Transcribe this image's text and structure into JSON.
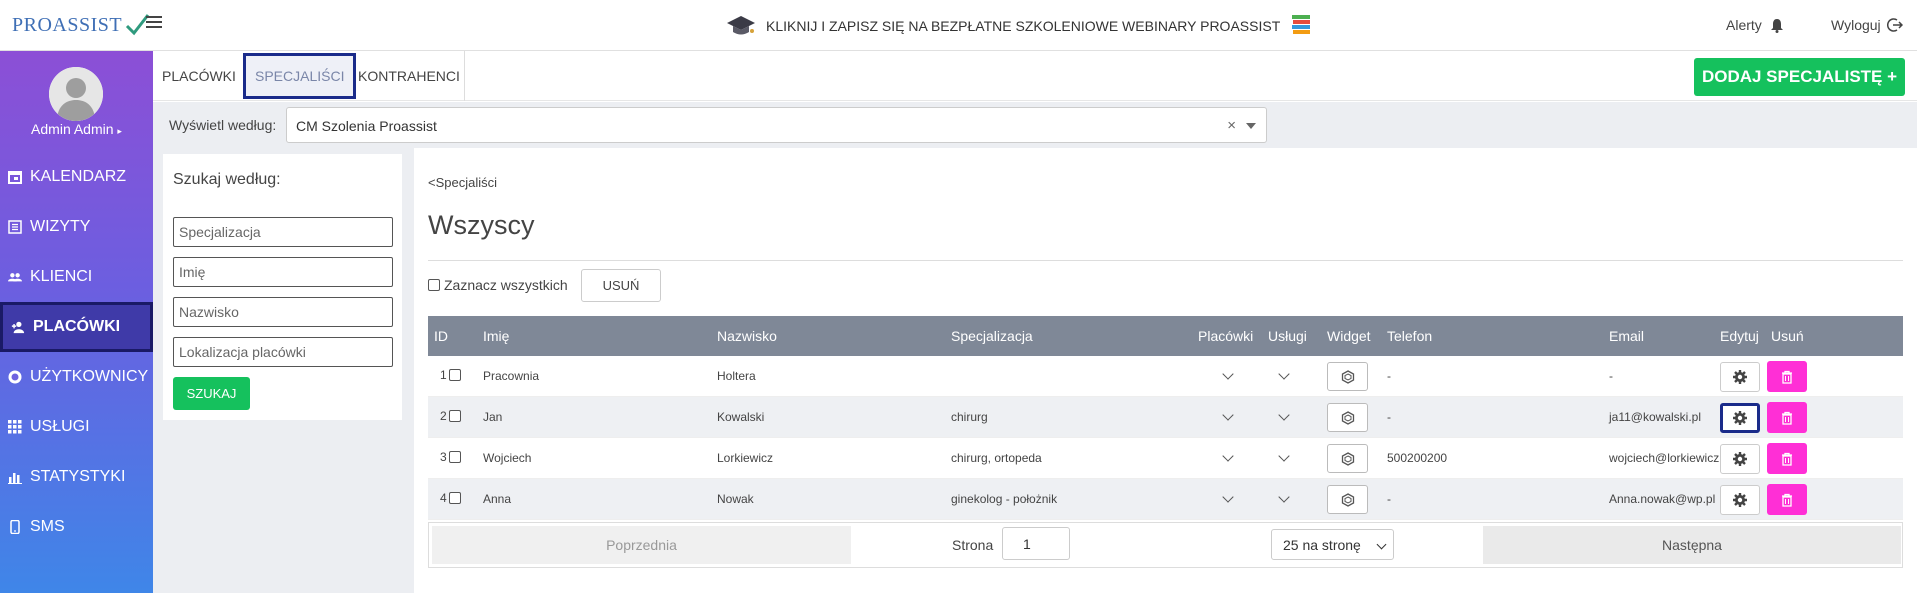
{
  "header": {
    "logo_text": "PROASSIST",
    "promo_text": "KLIKNIJ I ZAPISZ SIĘ NA BEZPŁATNE SZKOLENIOWE WEBINARY PROASSIST",
    "alerts_label": "Alerty",
    "logout_label": "Wyloguj"
  },
  "sidebar": {
    "user_name": "Admin Admin",
    "items": [
      {
        "label": "KALENDARZ",
        "icon": "calendar-icon"
      },
      {
        "label": "WIZYTY",
        "icon": "list-icon"
      },
      {
        "label": "KLIENCI",
        "icon": "users-icon"
      },
      {
        "label": "PLACÓWKI",
        "icon": "add-user-icon",
        "active": true
      },
      {
        "label": "UŻYTKOWNICY",
        "icon": "user-circle-icon"
      },
      {
        "label": "USŁUGI",
        "icon": "grid-icon"
      },
      {
        "label": "STATYSTYKI",
        "icon": "bar-chart-icon"
      },
      {
        "label": "SMS",
        "icon": "phone-icon"
      }
    ]
  },
  "tabs": {
    "items": [
      {
        "label": "PLACÓWKI"
      },
      {
        "label": "SPECJALIŚCI",
        "active": true
      },
      {
        "label": "KONTRAHENCI"
      }
    ],
    "add_button": "DODAJ SPECJALISTĘ +"
  },
  "filter": {
    "label": "Wyświetl według:",
    "value": "CM Szolenia Proassist",
    "clear": "×"
  },
  "search": {
    "title": "Szukaj według:",
    "placeholders": {
      "specialization": "Specjalizacja",
      "first_name": "Imię",
      "last_name": "Nazwisko",
      "location": "Lokalizacja placówki"
    },
    "button": "SZUKAJ"
  },
  "main": {
    "breadcrumb": "<Specjaliści",
    "title": "Wszyscy",
    "select_all": "Zaznacz wszystkich",
    "delete_button": "USUŃ"
  },
  "table": {
    "headers": {
      "id": "ID",
      "first_name": "Imię",
      "last_name": "Nazwisko",
      "specialization": "Specjalizacja",
      "facilities": "Placówki",
      "services": "Usługi",
      "widget": "Widget",
      "phone": "Telefon",
      "email": "Email",
      "edit": "Edytuj",
      "delete": "Usuń"
    },
    "rows": [
      {
        "id": "1",
        "first_name": "Pracownia",
        "last_name": "Holtera",
        "specialization": "",
        "phone": "-",
        "email": "-"
      },
      {
        "id": "2",
        "first_name": "Jan",
        "last_name": "Kowalski",
        "specialization": "chirurg",
        "phone": "-",
        "email": "ja11@kowalski.pl"
      },
      {
        "id": "3",
        "first_name": "Wojciech",
        "last_name": "Lorkiewicz",
        "specialization": "chirurg, ortopeda",
        "phone": "500200200",
        "email": "wojciech@lorkiewicz.pl"
      },
      {
        "id": "4",
        "first_name": "Anna",
        "last_name": "Nowak",
        "specialization": "ginekolog - położnik",
        "phone": "-",
        "email": "Anna.nowak@wp.pl"
      }
    ]
  },
  "pagination": {
    "prev": "Poprzednia",
    "page_label": "Strona",
    "page_value": "1",
    "per_page": "25 na stronę",
    "next": "Następna"
  },
  "colors": {
    "accent_green": "#15c15d",
    "delete_pink": "#ff2fd6",
    "sidebar_top": "#8c4fd6",
    "sidebar_bottom": "#3f86e8",
    "table_header": "#7f8897"
  }
}
